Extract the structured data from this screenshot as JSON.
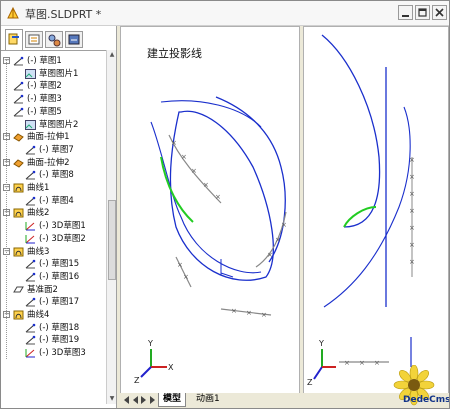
{
  "window": {
    "title": "草图.SLDPRT *",
    "buttons": [
      "minimize",
      "maximize",
      "close"
    ]
  },
  "feature_manager": {
    "tab_icons": [
      "feature-manager-icon",
      "property-manager-icon",
      "configuration-manager-icon",
      "dimxpert-icon"
    ],
    "items": [
      {
        "label": "(-) 草图1",
        "icon": "sketch-icon"
      },
      {
        "label": "草图图片1",
        "icon": "sketch-picture-icon"
      },
      {
        "label": "(-) 草图2",
        "icon": "sketch-icon"
      },
      {
        "label": "(-) 草图3",
        "icon": "sketch-icon"
      },
      {
        "label": "(-) 草图5",
        "icon": "sketch-icon"
      },
      {
        "label": "草图图片2",
        "icon": "sketch-picture-icon"
      },
      {
        "label": "曲面-拉伸1",
        "icon": "surface-extrude-icon"
      },
      {
        "label": "(-) 草图7",
        "icon": "sketch-icon"
      },
      {
        "label": "曲面-拉伸2",
        "icon": "surface-extrude-icon"
      },
      {
        "label": "(-) 草图8",
        "icon": "sketch-icon"
      },
      {
        "label": "曲线1",
        "icon": "curve-icon"
      },
      {
        "label": "(-) 草图4",
        "icon": "sketch-icon"
      },
      {
        "label": "曲线2",
        "icon": "curve-icon"
      },
      {
        "label": "(-) 3D草图1",
        "icon": "3d-sketch-icon"
      },
      {
        "label": "(-) 3D草图2",
        "icon": "3d-sketch-icon"
      },
      {
        "label": "曲线3",
        "icon": "curve-icon"
      },
      {
        "label": "(-) 草图15",
        "icon": "sketch-icon"
      },
      {
        "label": "(-) 草图16",
        "icon": "sketch-icon"
      },
      {
        "label": "基准面2",
        "icon": "plane-icon"
      },
      {
        "label": "(-) 草图17",
        "icon": "sketch-icon"
      },
      {
        "label": "曲线4",
        "icon": "curve-icon"
      },
      {
        "label": "(-) 草图18",
        "icon": "sketch-icon"
      },
      {
        "label": "(-) 草图19",
        "icon": "sketch-icon"
      },
      {
        "label": "(-) 3D草图3",
        "icon": "3d-sketch-icon"
      }
    ]
  },
  "viewport": {
    "annotation": "建立投影线",
    "axis_labels": {
      "x": "X",
      "y": "Y",
      "z": "Z"
    }
  },
  "sheet_tabs": [
    "模型",
    "动画1"
  ],
  "watermark": "DedeCmsV3",
  "colors": {
    "curve_blue": "#1a2fcc",
    "curve_green": "#22cc22",
    "projection_gray": "#888888",
    "axis_red": "#cc2222",
    "axis_green": "#22aa22",
    "axis_blue": "#2222cc"
  }
}
